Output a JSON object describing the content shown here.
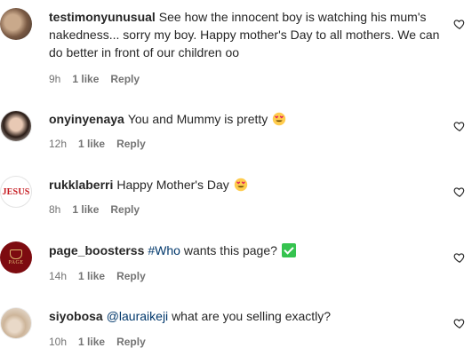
{
  "comments": [
    {
      "username": "testimonyunusual",
      "text": "See how the innocent boy is watching his mum's nakedness... sorry my boy. Happy mother's Day to all mothers. We can do better in front of our children oo",
      "time": "9h",
      "likes": "1 like",
      "reply": "Reply",
      "avatar_icon": "user-photo-icon"
    },
    {
      "username": "onyinyenaya",
      "text": "You and Mummy is pretty",
      "emoji": "heart-eyes-emoji",
      "time": "12h",
      "likes": "1 like",
      "reply": "Reply",
      "avatar_icon": "user-photo-icon"
    },
    {
      "username": "rukklaberri",
      "text": "Happy Mother's Day",
      "emoji": "heart-eyes-emoji",
      "time": "8h",
      "likes": "1 like",
      "reply": "Reply",
      "avatar_text": "JESUS"
    },
    {
      "username": "page_boosterss",
      "hashtag": "#Who",
      "text": "wants this page?",
      "emoji": "check-mark-button-emoji",
      "time": "14h",
      "likes": "1 like",
      "reply": "Reply",
      "avatar_text": "PAGE"
    },
    {
      "username": "siyobosa",
      "mention": "@lauraikeji",
      "text": "what are you selling exactly?",
      "time": "10h",
      "likes": "1 like",
      "reply": "Reply",
      "avatar_icon": "user-photo-icon"
    }
  ],
  "colors": {
    "text": "#262626",
    "meta": "#737373",
    "link": "#00376b",
    "emoji_face": "#ffcc4d",
    "emoji_heart": "#e0245e",
    "check_green": "#35c34f"
  }
}
